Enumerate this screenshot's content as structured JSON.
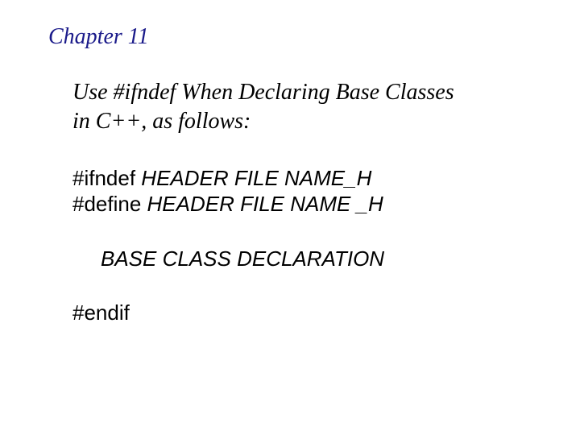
{
  "chapter": {
    "title": "Chapter 11"
  },
  "intro": {
    "line1": "Use #ifndef When Declaring Base Classes",
    "line2": "in C++, as follows:"
  },
  "code": {
    "line1_keyword": "#ifndef ",
    "line1_name": "HEADER FILE NAME_H",
    "line2_keyword": "#define ",
    "line2_name": "HEADER FILE NAME _H",
    "line3": "BASE CLASS DECLARATION",
    "line4": "#endif"
  }
}
